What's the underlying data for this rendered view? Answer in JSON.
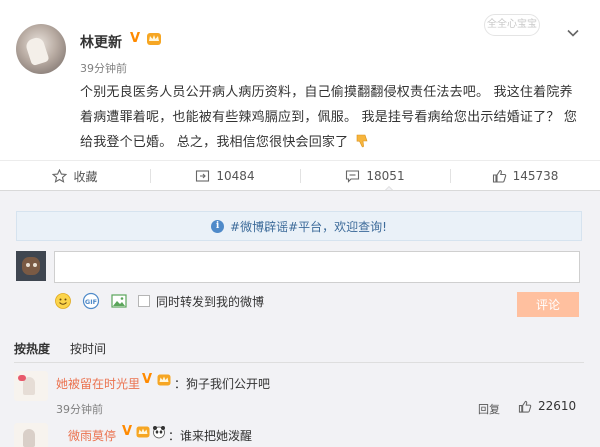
{
  "post": {
    "username": "林更新",
    "time": "39分钟前",
    "watermark": "全全心宝宝",
    "text": "个别无良医务人员公开病人病历资料，自己偷摸翻翻侵权责任法去吧。 我这住着院养着病遭罪着呢，也能被有些辣鸡膈应到，佩服。 我是挂号看病给您出示结婚证了？ 您给我登个已婚。 总之，我相信您很快会回家了"
  },
  "actions": {
    "favorite_label": "收藏",
    "repost_count": "10484",
    "comment_count": "18051",
    "like_count": "145738"
  },
  "comments_panel": {
    "notice": "#微博辟谣#平台，欢迎查询!",
    "input_value": "",
    "forward_label": "同时转发到我的微博",
    "submit_label": "评论",
    "sort_hot": "按热度",
    "sort_time": "按时间"
  },
  "comments": [
    {
      "name": "她被留在时光里",
      "text": "：狗子我们公开吧",
      "time": "39分钟前",
      "reply_label": "回复",
      "likes": "22610"
    },
    {
      "name": "微雨莫停",
      "text": "：谁来把她泼醒"
    }
  ],
  "colors": {
    "accent_orange": "#eb7350",
    "submit_button": "#ffc09f",
    "notice_bg": "#eaf1f8",
    "verified_badge": "#ff8a00"
  }
}
